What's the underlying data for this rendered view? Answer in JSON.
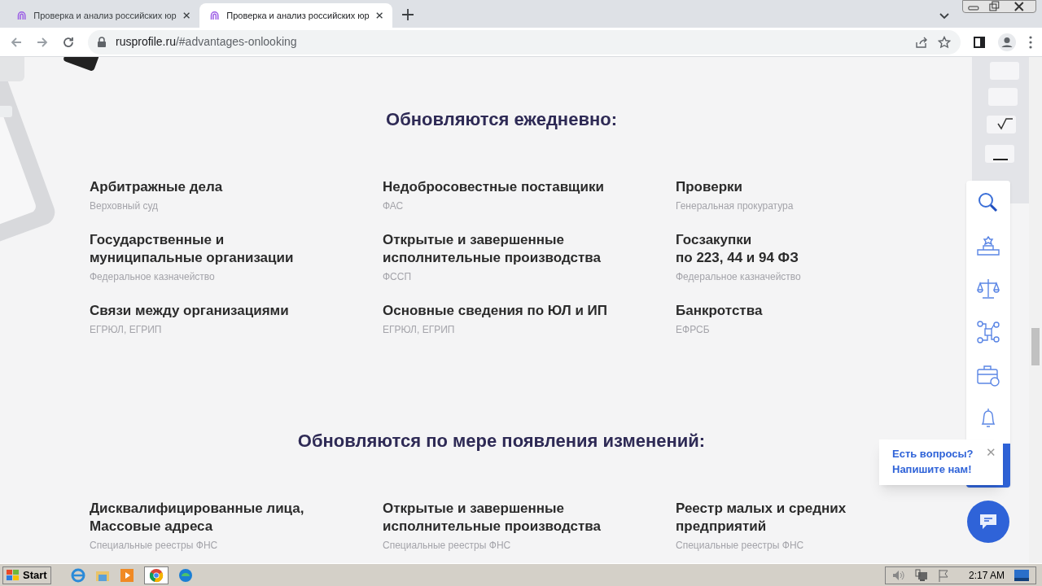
{
  "browser": {
    "tabs": [
      {
        "title": "Проверка и анализ российских юр",
        "selected": false
      },
      {
        "title": "Проверка и анализ российских юр",
        "selected": true
      }
    ],
    "address": {
      "host": "rusprofile.ru",
      "path": "/#advantages-onlooking"
    }
  },
  "sections": [
    {
      "title": "Обновляются ежедневно:",
      "items": [
        {
          "title": "Арбитражные дела",
          "source": "Верховный суд"
        },
        {
          "title": "Недобросовестные поставщики",
          "source": "ФАС"
        },
        {
          "title": "Проверки",
          "source": "Генеральная прокуратура"
        },
        {
          "title": "Государственные и\nмуниципальные организации",
          "source": "Федеральное казначейство"
        },
        {
          "title": "Открытые и завершенные\nисполнительные производства",
          "source": "ФССП"
        },
        {
          "title": "Госзакупки\nпо 223, 44 и 94 ФЗ",
          "source": "Федеральное казначейство"
        },
        {
          "title": "Связи между организациями",
          "source": "ЕГРЮЛ, ЕГРИП"
        },
        {
          "title": "Основные сведения по ЮЛ и ИП",
          "source": "ЕГРЮЛ, ЕГРИП"
        },
        {
          "title": "Банкротства",
          "source": "ЕФРСБ"
        }
      ]
    },
    {
      "title": "Обновляются по мере появления изменений:",
      "items": [
        {
          "title": "Дисквалифицированные лица,\nМассовые адреса",
          "source": "Специальные реестры ФНС"
        },
        {
          "title": "Открытые и завершенные\nисполнительные производства",
          "source": "Специальные реестры ФНС"
        },
        {
          "title": "Реестр малых и средних\nпредприятий",
          "source": "Специальные реестры ФНС"
        }
      ]
    }
  ],
  "chat_popup": {
    "text": "Есть вопросы?\nНапишите нам!",
    "close": "✕"
  },
  "taskbar": {
    "start": "Start",
    "clock": "2:17 AM"
  }
}
